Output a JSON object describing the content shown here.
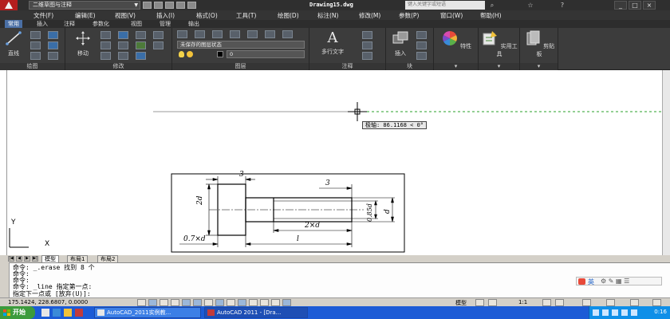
{
  "title_bar": {
    "workspace": "二维草图与注释",
    "document_title": "Drawing15.dwg",
    "search_placeholder": "键入关键字或短语"
  },
  "menu": [
    "文件(F)",
    "编辑(E)",
    "视图(V)",
    "插入(I)",
    "格式(O)",
    "工具(T)",
    "绘图(D)",
    "标注(N)",
    "修改(M)",
    "参数(P)",
    "窗口(W)",
    "帮助(H)"
  ],
  "ribbon_tabs": [
    "常用",
    "插入",
    "注释",
    "参数化",
    "视图",
    "管理",
    "输出"
  ],
  "ribbon": {
    "draw_panel": "绘图",
    "line_label": "直线",
    "modify_panel": "修改",
    "move_label": "移动",
    "layers_panel": "图层",
    "layer_state": "未保存的图层状态",
    "layer_current": "0",
    "annotation_panel": "注释",
    "mtext_label": "多行文字",
    "block_panel": "块",
    "insert_label": "插入",
    "properties_label": "特性",
    "utilities_label": "实用工具",
    "clipboard_label": "剪贴板"
  },
  "drawing": {
    "polar_tooltip": "极轴: 86.1168 < 0°",
    "dims": {
      "top_left": "3",
      "top_right": "3",
      "left_height": "2d",
      "right_height": "d",
      "inner_height": "0.85d",
      "shaft_len": "2×d",
      "head_len": "0.7×d",
      "total_len": "l"
    },
    "ucs_y": "Y",
    "ucs_x": "X"
  },
  "layout_tabs": [
    "模型",
    "布局1",
    "布局2"
  ],
  "command_lines": [
    "命令: _.erase 找到 8 个",
    "命令:",
    "命令:",
    "命令: _line 指定第一点:",
    "指定下一点或 [放弃(U)]:"
  ],
  "status": {
    "coords": "175.1424, 228.6807, 0.0000",
    "model": "模型",
    "scale": "1:1"
  },
  "taskbar": {
    "start": "开始",
    "items": [
      "AutoCAD_2011实例教...",
      "AutoCAD 2011 - [Dra..."
    ],
    "time": "0:16"
  },
  "colors": {
    "accent_tab": "#4a6fa5",
    "app_red": "#b41e1e",
    "taskbar_blue": "#1c5bd6",
    "start_green": "#3c9b3c"
  }
}
